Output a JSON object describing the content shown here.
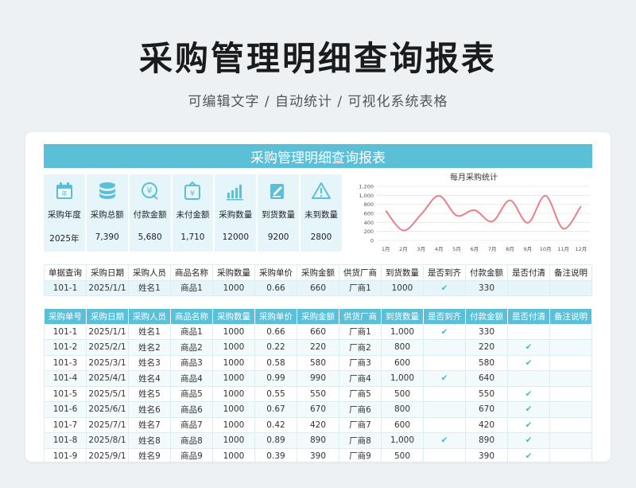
{
  "header": {
    "title": "采购管理明细查询报表",
    "subtitle": "可编辑文字 / 自动统计 / 可视化系统表格"
  },
  "report": {
    "banner": "采购管理明细查询报表"
  },
  "kpis": [
    {
      "icon": "calendar-icon",
      "label": "采购年度",
      "value": "2025年"
    },
    {
      "icon": "coins-icon",
      "label": "采购总额",
      "value": "7,390"
    },
    {
      "icon": "yen-coin-icon",
      "label": "付款金额",
      "value": "5,680"
    },
    {
      "icon": "yen-bag-icon",
      "label": "未付金额",
      "value": "1,710"
    },
    {
      "icon": "bar-chart-icon",
      "label": "采购数量",
      "value": "12000"
    },
    {
      "icon": "document-edit-icon",
      "label": "到货数量",
      "value": "9200"
    },
    {
      "icon": "warning-icon",
      "label": "未到数量",
      "value": "2800"
    }
  ],
  "chart_data": {
    "type": "line",
    "title": "每月采购统计",
    "categories": [
      "1月",
      "2月",
      "3月",
      "4月",
      "5月",
      "6月",
      "7月",
      "8月",
      "9月",
      "10月",
      "11月",
      "12月"
    ],
    "yticks": [
      "0",
      "200",
      "400",
      "600",
      "800",
      "1,000",
      "1,200"
    ],
    "ylim": [
      0,
      1200
    ],
    "grid": true,
    "series": [
      {
        "values": [
          660,
          220,
          580,
          990,
          550,
          670,
          420,
          890,
          390,
          990,
          260,
          760
        ]
      }
    ],
    "color": "#e8818b"
  },
  "query": {
    "headers": [
      "单据查询",
      "采购日期",
      "采购人员",
      "商品名称",
      "采购数量",
      "采购单价",
      "采购金额",
      "供货厂商",
      "到货数量",
      "是否到齐",
      "付款金额",
      "是否付清",
      "备注说明"
    ],
    "row": [
      "101-1",
      "2025/1/1",
      "姓名1",
      "商品1",
      "1000",
      "0.66",
      "660",
      "厂商1",
      "1000",
      "✔",
      "330",
      "",
      ""
    ]
  },
  "detail": {
    "headers": [
      "采购单号",
      "采购日期",
      "采购人员",
      "商品名称",
      "采购数量",
      "采购单价",
      "采购金额",
      "供货厂商",
      "到货数量",
      "是否到齐",
      "付款金额",
      "是否付清",
      "备注说明"
    ],
    "rows": [
      [
        "101-1",
        "2025/1/1",
        "姓名1",
        "商品1",
        "1000",
        "0.66",
        "660",
        "厂商1",
        "1,000",
        "✔",
        "330",
        "",
        ""
      ],
      [
        "101-2",
        "2025/2/1",
        "姓名2",
        "商品2",
        "1000",
        "0.22",
        "220",
        "厂商2",
        "800",
        "",
        "220",
        "✔",
        ""
      ],
      [
        "101-3",
        "2025/3/1",
        "姓名3",
        "商品3",
        "1000",
        "0.58",
        "580",
        "厂商3",
        "600",
        "",
        "580",
        "✔",
        ""
      ],
      [
        "101-4",
        "2025/4/1",
        "姓名4",
        "商品4",
        "1000",
        "0.99",
        "990",
        "厂商4",
        "1,000",
        "✔",
        "640",
        "",
        ""
      ],
      [
        "101-5",
        "2025/5/1",
        "姓名5",
        "商品5",
        "1000",
        "0.55",
        "550",
        "厂商5",
        "500",
        "",
        "550",
        "✔",
        ""
      ],
      [
        "101-6",
        "2025/6/1",
        "姓名6",
        "商品6",
        "1000",
        "0.67",
        "670",
        "厂商6",
        "800",
        "",
        "670",
        "✔",
        ""
      ],
      [
        "101-7",
        "2025/7/1",
        "姓名7",
        "商品7",
        "1000",
        "0.42",
        "420",
        "厂商7",
        "600",
        "",
        "420",
        "✔",
        ""
      ],
      [
        "101-8",
        "2025/8/1",
        "姓名8",
        "商品8",
        "1000",
        "0.89",
        "890",
        "厂商8",
        "1,000",
        "✔",
        "890",
        "✔",
        ""
      ],
      [
        "101-9",
        "2025/9/1",
        "姓名9",
        "商品9",
        "1000",
        "0.39",
        "390",
        "厂商9",
        "500",
        "",
        "390",
        "✔",
        ""
      ]
    ]
  }
}
